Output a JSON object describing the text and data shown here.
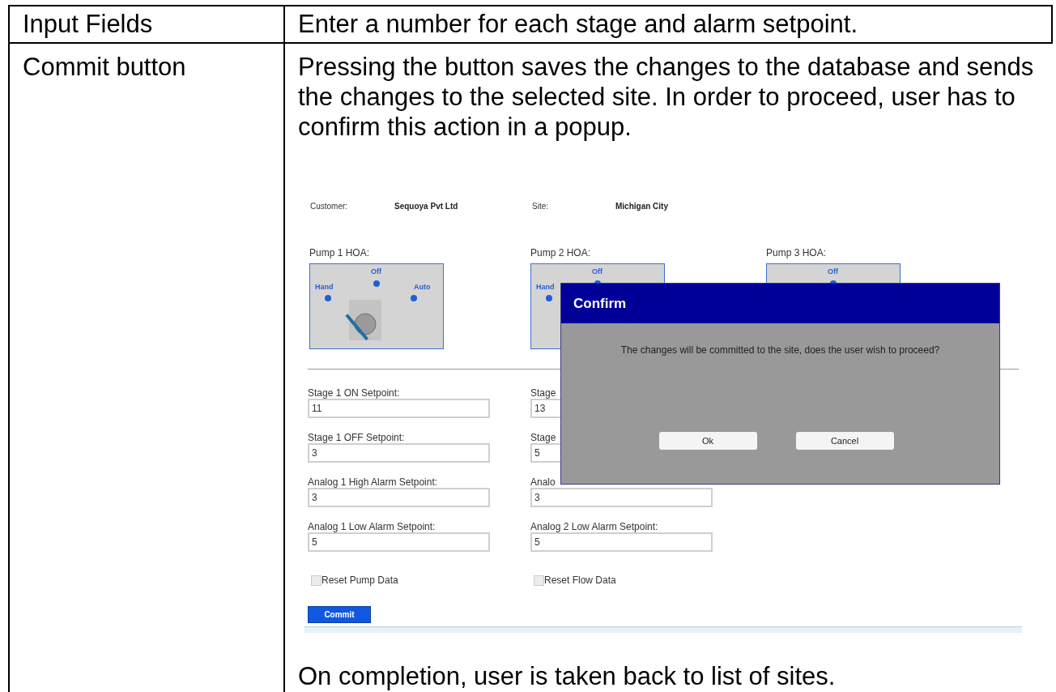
{
  "table": {
    "rows": [
      {
        "term": "Input Fields",
        "text": "Enter a number for each stage and alarm setpoint."
      },
      {
        "term": "Commit button",
        "text": "Pressing the button saves the changes to the database and sends the changes to the selected site. In order to proceed, user has to confirm this action in a popup.",
        "after_text": "On completion, user is taken back to list of sites.",
        "screenshot": {
          "customer_label": "Customer:",
          "customer": "Sequoya Pvt Ltd",
          "site_label": "Site:",
          "site": "Michigan City",
          "pumps": [
            {
              "title": "Pump 1 HOA:",
              "positions": [
                {
                  "kind": "hand",
                  "label": "Hand",
                  "selected": true
                },
                {
                  "kind": "off",
                  "label": "Off",
                  "selected": false
                },
                {
                  "kind": "auto",
                  "label": "Auto",
                  "selected": false
                }
              ]
            },
            {
              "title": "Pump 2 HOA:",
              "positions": [
                {
                  "kind": "hand",
                  "label": "Hand"
                },
                {
                  "kind": "off",
                  "label": "Off"
                }
              ]
            },
            {
              "title": "Pump 3 HOA:",
              "positions": [
                {
                  "kind": "off",
                  "label": "Off"
                }
              ]
            }
          ],
          "field_columns": [
            [
              {
                "label": "Stage 1 ON Setpoint:",
                "value": "11"
              },
              {
                "label": "Stage 1 OFF Setpoint:",
                "value": "3"
              },
              {
                "label": "Analog 1 High Alarm Setpoint:",
                "value": "3"
              },
              {
                "label": "Analog 1 Low Alarm Setpoint:",
                "value": "5"
              }
            ],
            [
              {
                "label": "Stage",
                "value": "13"
              },
              {
                "label": "Stage",
                "value": "5"
              },
              {
                "label": "Analo",
                "value": "3"
              },
              {
                "label": "Analog 2 Low Alarm Setpoint:",
                "value": "5"
              }
            ]
          ],
          "checkboxes": [
            {
              "label": "Reset Pump Data",
              "checked": false
            },
            {
              "label": "Reset Flow Data",
              "checked": false
            }
          ],
          "commit": "Commit",
          "dialog": {
            "title": "Confirm",
            "message": "The changes will be committed to the site, does the user wish to proceed?",
            "buttons": [
              "Ok",
              "Cancel"
            ]
          }
        }
      }
    ]
  }
}
